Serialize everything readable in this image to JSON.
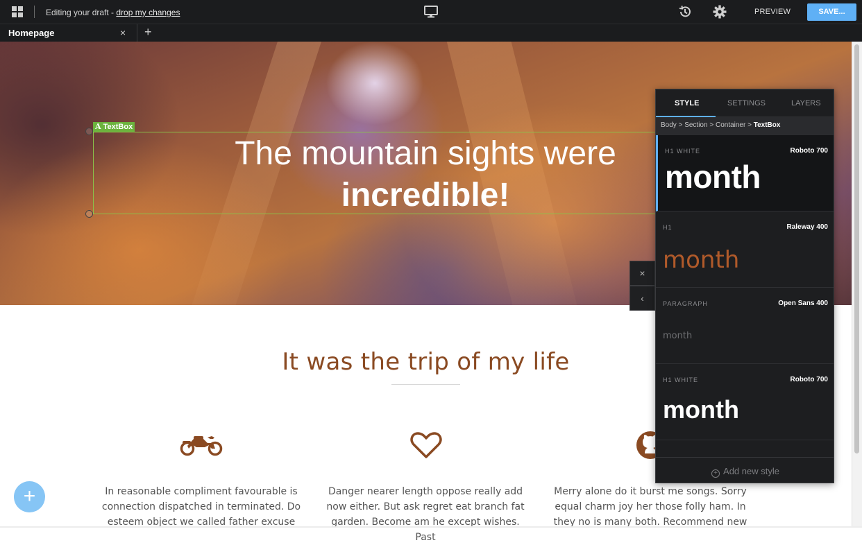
{
  "topbar": {
    "draft_prefix": "Editing your draft - ",
    "drop_link": "drop my changes",
    "preview_label": "PREVIEW",
    "save_label": "SAVE...",
    "icons": [
      "grid-icon",
      "monitor-icon",
      "history-icon",
      "gear-icon"
    ]
  },
  "tabs": [
    {
      "label": "Homepage",
      "close": "×"
    }
  ],
  "tab_add": "+",
  "hero": {
    "element_label": "TextBox",
    "title_line1": "The mountain sights were",
    "title_line2": "incredible!",
    "side_controls": {
      "close": "×",
      "collapse": "‹"
    }
  },
  "content": {
    "heading": "It was the trip of my life",
    "features": [
      {
        "icon": "motorcycle-icon",
        "text": "In reasonable compliment favourable is connection dispatched in terminated. Do esteem object we called father excuse"
      },
      {
        "icon": "heart-icon",
        "text": "Danger nearer length oppose really add now either. But ask regret eat branch fat garden. Become am he except wishes. Past"
      },
      {
        "icon": "github-icon",
        "text": "Merry alone do it burst me songs. Sorry equal charm joy her those folly ham. In they no is many both. Recommend new"
      }
    ],
    "fab_label": "+"
  },
  "style_panel": {
    "tabs": [
      "STYLE",
      "SETTINGS",
      "LAYERS"
    ],
    "active_tab": "STYLE",
    "breadcrumb": [
      "Body",
      "Section",
      "Container"
    ],
    "breadcrumb_current": "TextBox",
    "styles": [
      {
        "name": "H1 WHITE",
        "font": "Roboto 700",
        "preview": "month",
        "selected": true
      },
      {
        "name": "H1",
        "font": "Raleway 400",
        "preview": "month",
        "selected": false
      },
      {
        "name": "PARAGRAPH",
        "font": "Open Sans 400",
        "preview": "month",
        "selected": false
      },
      {
        "name": "H1 WHITE",
        "font": "Roboto 700",
        "preview": "month",
        "selected": false
      }
    ],
    "add_style_label": "Add new style"
  },
  "colors": {
    "accent": "#5fb0f5",
    "brand_brown": "#8a4a22",
    "selection_green": "#8bc34a",
    "topbar_bg": "#1b1c1e"
  }
}
